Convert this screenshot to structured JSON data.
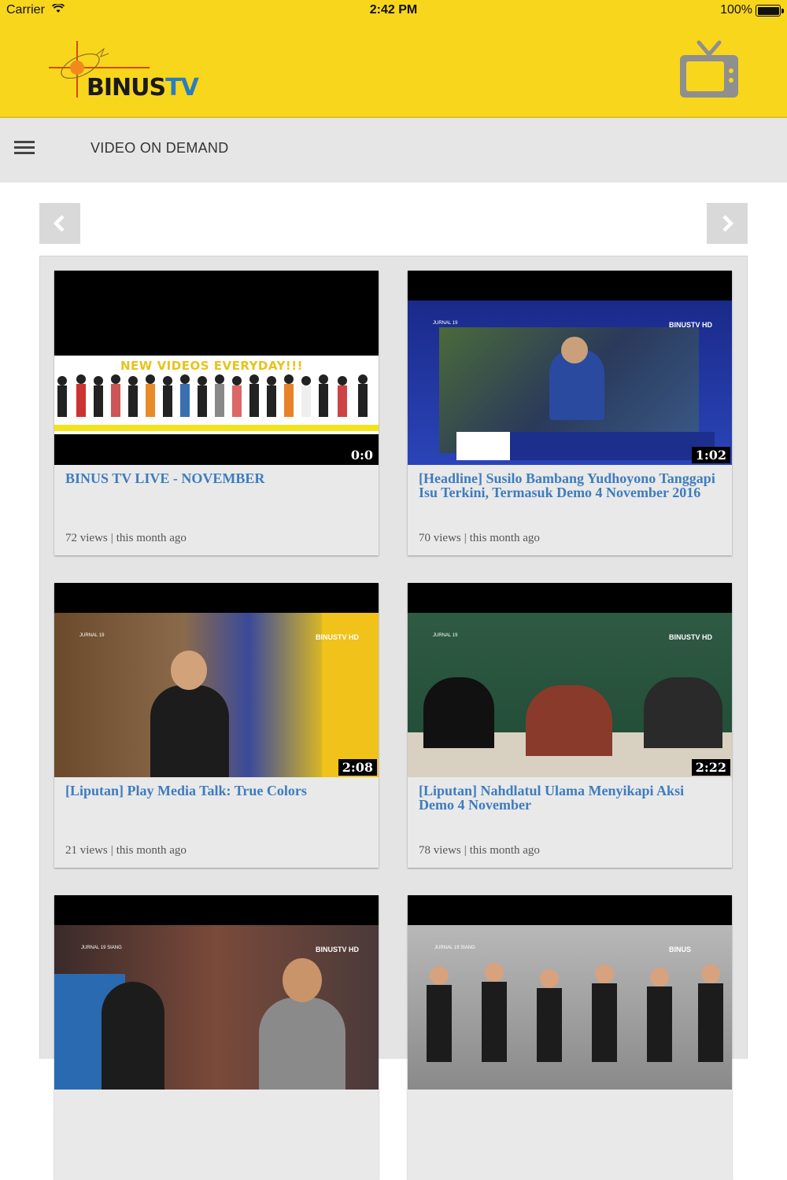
{
  "status_bar": {
    "carrier": "Carrier",
    "time": "2:42 PM",
    "battery": "100%"
  },
  "header": {
    "logo_text_dark": "BINUS",
    "logo_text_blue": "TV",
    "tv_icon": "tv-icon"
  },
  "navbar": {
    "menu_icon": "hamburger-menu-icon",
    "title": "VIDEO ON DEMAND"
  },
  "pager": {
    "prev_icon": "chevron-left-icon",
    "next_icon": "chevron-right-icon"
  },
  "videos": [
    {
      "title": "BINUS TV LIVE - NOVEMBER",
      "duration": "0:0",
      "views": "72 views",
      "age": "this month ago",
      "banner_text": "NEW VIDEOS EVERYDAY!!!"
    },
    {
      "title": "[Headline] Susilo Bambang Yudhoyono Tanggapi Isu Terkini, Termasuk Demo 4 November 2016",
      "duration": "1:02",
      "views": "70 views",
      "age": "this month ago",
      "overlay_brand": "BINUSTV HD",
      "overlay_show": "JURNAL 19"
    },
    {
      "title": "[Liputan] Play Media Talk: True Colors",
      "duration": "2:08",
      "views": "21 views",
      "age": "this month ago",
      "overlay_brand": "BINUSTV HD",
      "overlay_show": "JURNAL 19"
    },
    {
      "title": "[Liputan] Nahdlatul Ulama Menyikapi Aksi Demo 4 November",
      "duration": "2:22",
      "views": "78 views",
      "age": "this month ago",
      "overlay_brand": "BINUSTV HD",
      "overlay_show": "JURNAL 19"
    },
    {
      "title": "",
      "duration": "",
      "views": "",
      "age": "",
      "overlay_brand": "BINUSTV HD",
      "overlay_show": "JURNAL 19 SIANG"
    },
    {
      "title": "",
      "duration": "",
      "views": "",
      "age": "",
      "overlay_brand": "BINUS",
      "overlay_show": "JURNAL 19 SIANG"
    }
  ],
  "colors": {
    "header_yellow": "#f8d61c",
    "title_blue": "#3d7cbf",
    "navbar_gray": "#e6e6e6"
  }
}
